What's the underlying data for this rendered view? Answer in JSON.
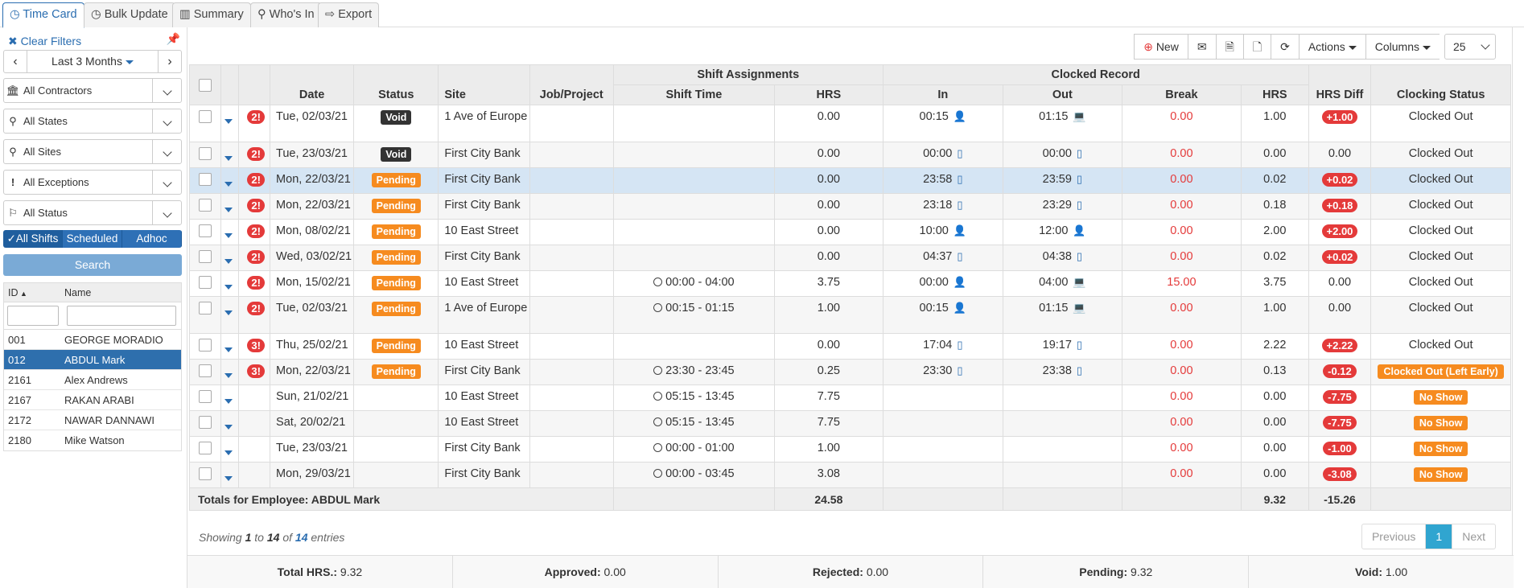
{
  "tabs": [
    {
      "label": "Time Card",
      "icon": "clock-icon"
    },
    {
      "label": "Bulk Update",
      "icon": "clock-icon"
    },
    {
      "label": "Summary",
      "icon": "bar-chart-icon"
    },
    {
      "label": "Who's In",
      "icon": "map-marker-icon"
    },
    {
      "label": "Export",
      "icon": "export-icon"
    }
  ],
  "sidebar": {
    "clear_filters": "Clear Filters",
    "period": "Last 3 Months",
    "filters": [
      {
        "label": "All Contractors",
        "icon": "bank-icon"
      },
      {
        "label": "All States",
        "icon": "map-marker-icon"
      },
      {
        "label": "All Sites",
        "icon": "map-marker-icon"
      },
      {
        "label": "All Exceptions",
        "icon": "exclamation-icon"
      },
      {
        "label": "All Status",
        "icon": "flag-icon"
      }
    ],
    "shift_toggle": [
      "All Shifts",
      "Scheduled",
      "Adhoc"
    ],
    "search_label": "Search",
    "employee_table": {
      "headers": [
        "ID",
        "Name"
      ],
      "rows": [
        {
          "id": "001",
          "name": "GEORGE MORADIO"
        },
        {
          "id": "012",
          "name": "ABDUL Mark"
        },
        {
          "id": "2161",
          "name": "Alex Andrews"
        },
        {
          "id": "2167",
          "name": "RAKAN ARABI"
        },
        {
          "id": "2172",
          "name": "NAWAR DANNAWI"
        },
        {
          "id": "2180",
          "name": "Mike Watson"
        }
      ],
      "selected": "012"
    }
  },
  "toolbar": {
    "new_label": "New",
    "actions_label": "Actions",
    "columns_label": "Columns",
    "page_size": "25"
  },
  "table": {
    "group_headers": {
      "shift": "Shift Assignments",
      "clocked": "Clocked Record"
    },
    "headers": [
      "Date",
      "Status",
      "Site",
      "Job/Project",
      "Shift Time",
      "HRS",
      "In",
      "Out",
      "Break",
      "HRS",
      "HRS Diff",
      "Clocking Status"
    ],
    "rows": [
      {
        "exc": "2!",
        "date": "Tue, 02/03/21",
        "status": "Void",
        "site": "1 Ave of Europe",
        "shift_time": "",
        "hrs": "0.00",
        "in": "00:15",
        "in_dev": "user",
        "out": "01:15",
        "out_dev": "laptop",
        "brk": "0.00",
        "chrs": "1.00",
        "diff": "+1.00",
        "cstatus": "Clocked Out"
      },
      {
        "exc": "2!",
        "date": "Tue, 23/03/21",
        "status": "Void",
        "site": "First City Bank",
        "shift_time": "",
        "hrs": "0.00",
        "in": "00:00",
        "in_dev": "mobile",
        "out": "00:00",
        "out_dev": "mobile",
        "brk": "0.00",
        "chrs": "0.00",
        "diff": "0.00",
        "cstatus": "Clocked Out"
      },
      {
        "exc": "2!",
        "date": "Mon, 22/03/21",
        "status": "Pending",
        "site": "First City Bank",
        "shift_time": "",
        "hrs": "0.00",
        "in": "23:58",
        "in_dev": "mobile",
        "out": "23:59",
        "out_dev": "mobile",
        "brk": "0.00",
        "chrs": "0.02",
        "diff": "+0.02",
        "cstatus": "Clocked Out"
      },
      {
        "exc": "2!",
        "date": "Mon, 22/03/21",
        "status": "Pending",
        "site": "First City Bank",
        "shift_time": "",
        "hrs": "0.00",
        "in": "23:18",
        "in_dev": "mobile",
        "out": "23:29",
        "out_dev": "mobile",
        "brk": "0.00",
        "chrs": "0.18",
        "diff": "+0.18",
        "cstatus": "Clocked Out"
      },
      {
        "exc": "2!",
        "date": "Mon, 08/02/21",
        "status": "Pending",
        "site": "10 East Street",
        "shift_time": "",
        "hrs": "0.00",
        "in": "10:00",
        "in_dev": "user",
        "out": "12:00",
        "out_dev": "user",
        "brk": "0.00",
        "chrs": "2.00",
        "diff": "+2.00",
        "cstatus": "Clocked Out"
      },
      {
        "exc": "2!",
        "date": "Wed, 03/02/21",
        "status": "Pending",
        "site": "First City Bank",
        "shift_time": "",
        "hrs": "0.00",
        "in": "04:37",
        "in_dev": "mobile",
        "out": "04:38",
        "out_dev": "mobile",
        "brk": "0.00",
        "chrs": "0.02",
        "diff": "+0.02",
        "cstatus": "Clocked Out"
      },
      {
        "exc": "2!",
        "date": "Mon, 15/02/21",
        "status": "Pending",
        "site": "10 East Street",
        "shift_time": "00:00 - 04:00",
        "hrs": "3.75",
        "in": "00:00",
        "in_dev": "user",
        "out": "04:00",
        "out_dev": "laptop",
        "brk": "15.00",
        "chrs": "3.75",
        "diff": "0.00",
        "cstatus": "Clocked Out"
      },
      {
        "exc": "2!",
        "date": "Tue, 02/03/21",
        "status": "Pending",
        "site": "1 Ave of Europe",
        "shift_time": "00:15 - 01:15",
        "hrs": "1.00",
        "in": "00:15",
        "in_dev": "user",
        "out": "01:15",
        "out_dev": "laptop",
        "brk": "0.00",
        "chrs": "1.00",
        "diff": "0.00",
        "cstatus": "Clocked Out"
      },
      {
        "exc": "3!",
        "date": "Thu, 25/02/21",
        "status": "Pending",
        "site": "10 East Street",
        "shift_time": "",
        "hrs": "0.00",
        "in": "17:04",
        "in_dev": "mobile",
        "out": "19:17",
        "out_dev": "mobile",
        "brk": "0.00",
        "chrs": "2.22",
        "diff": "+2.22",
        "cstatus": "Clocked Out"
      },
      {
        "exc": "3!",
        "date": "Mon, 22/03/21",
        "status": "Pending",
        "site": "First City Bank",
        "shift_time": "23:30 - 23:45",
        "hrs": "0.25",
        "in": "23:30",
        "in_dev": "mobile",
        "out": "23:38",
        "out_dev": "mobile",
        "brk": "0.00",
        "chrs": "0.13",
        "diff": "-0.12",
        "cstatus": "Clocked Out (Left Early)"
      },
      {
        "exc": "",
        "date": "Sun, 21/02/21",
        "status": "",
        "site": "10 East Street",
        "shift_time": "05:15 - 13:45",
        "hrs": "7.75",
        "in": "",
        "in_dev": "",
        "out": "",
        "out_dev": "",
        "brk": "0.00",
        "chrs": "0.00",
        "diff": "-7.75",
        "cstatus": "No Show"
      },
      {
        "exc": "",
        "date": "Sat, 20/02/21",
        "status": "",
        "site": "10 East Street",
        "shift_time": "05:15 - 13:45",
        "hrs": "7.75",
        "in": "",
        "in_dev": "",
        "out": "",
        "out_dev": "",
        "brk": "0.00",
        "chrs": "0.00",
        "diff": "-7.75",
        "cstatus": "No Show"
      },
      {
        "exc": "",
        "date": "Tue, 23/03/21",
        "status": "",
        "site": "First City Bank",
        "shift_time": "00:00 - 01:00",
        "hrs": "1.00",
        "in": "",
        "in_dev": "",
        "out": "",
        "out_dev": "",
        "brk": "0.00",
        "chrs": "0.00",
        "diff": "-1.00",
        "cstatus": "No Show"
      },
      {
        "exc": "",
        "date": "Mon, 29/03/21",
        "status": "",
        "site": "First City Bank",
        "shift_time": "00:00 - 03:45",
        "hrs": "3.08",
        "in": "",
        "in_dev": "",
        "out": "",
        "out_dev": "",
        "brk": "0.00",
        "chrs": "0.00",
        "diff": "-3.08",
        "cstatus": "No Show"
      }
    ],
    "totals": {
      "label": "Totals for Employee: ABDUL Mark",
      "hrs": "24.58",
      "chrs": "9.32",
      "diff": "-15.26"
    }
  },
  "footer": {
    "showing_prefix": "Showing",
    "from": "1",
    "to": "14",
    "total": "14",
    "showing_suffix": "entries",
    "pager": {
      "prev": "Previous",
      "current": "1",
      "next": "Next"
    },
    "summary": [
      {
        "label": "Total HRS.:",
        "value": "9.32"
      },
      {
        "label": "Approved:",
        "value": "0.00"
      },
      {
        "label": "Rejected:",
        "value": "0.00"
      },
      {
        "label": "Pending:",
        "value": "9.32"
      },
      {
        "label": "Void:",
        "value": "1.00"
      }
    ]
  },
  "colors": {
    "accent": "#2a6db0",
    "danger": "#e43a3a",
    "pending": "#f68b1f",
    "void": "#333333",
    "highlight_row": "#d5e5f4"
  }
}
